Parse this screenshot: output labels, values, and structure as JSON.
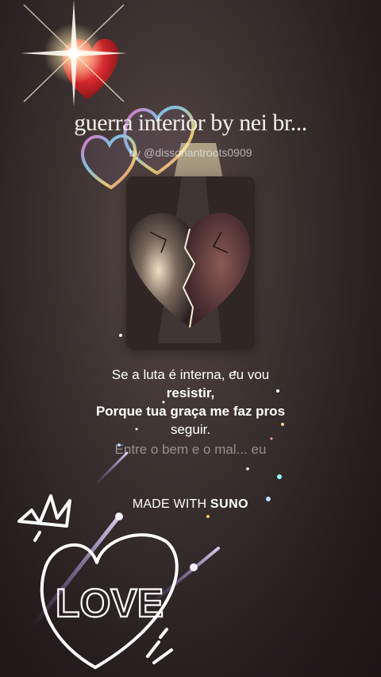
{
  "song": {
    "title": "guerra interior by nei br...",
    "artist": "by @dissonantroots0909"
  },
  "lyrics": {
    "line1": "Se a luta é interna, eu vou",
    "line2": "resistir,",
    "line3": "Porque tua graça me faz pros",
    "line4": "seguir.",
    "line5": "Entre o bem e o mal... eu"
  },
  "footer": {
    "made_with_prefix": "MADE WITH",
    "made_with_brand": "SUNO"
  },
  "sticker": {
    "love_text": "LOVE"
  },
  "colors": {
    "background": "#2b2324",
    "text": "#ffffff",
    "heart_red": "#c2202a"
  },
  "icons": [
    "red-heart-icon",
    "bubble-heart-icon",
    "broken-heart-artwork",
    "love-heart-doodle",
    "crown-doodle"
  ]
}
